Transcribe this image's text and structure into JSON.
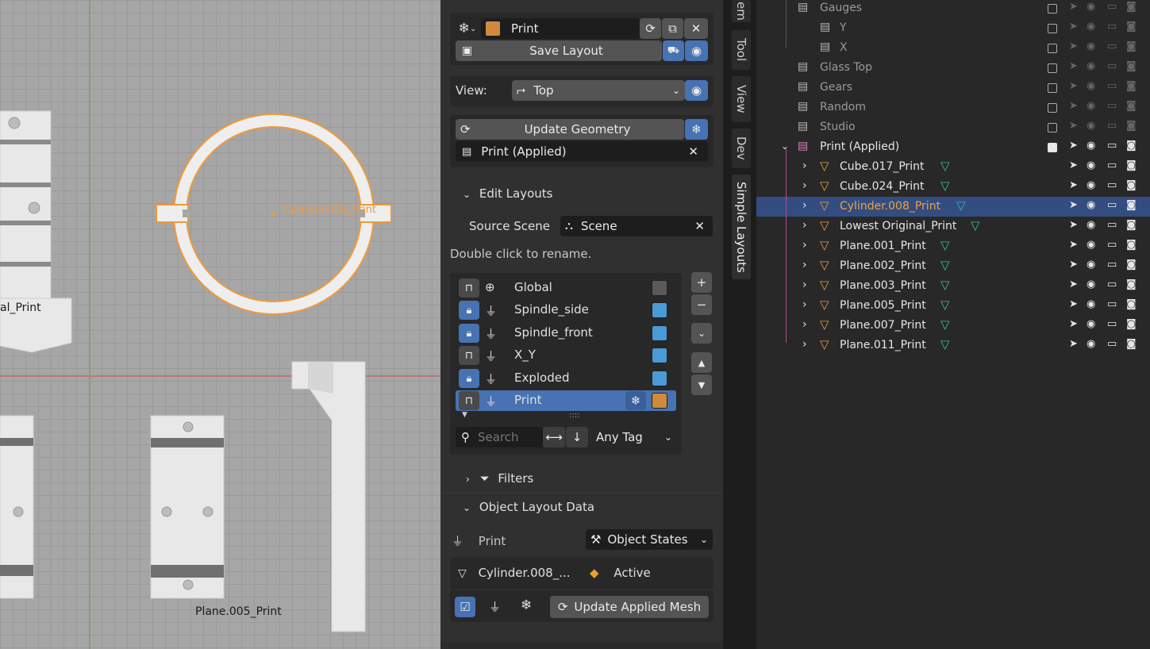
{
  "viewport": {
    "labels": {
      "cylinder": "Cylinder.008_Print",
      "plane005": "Plane.005_Print",
      "lowest": "al_Print"
    }
  },
  "npanel": {
    "layout": {
      "name": "Print",
      "save_label": "Save Layout",
      "color": "#d08a3c"
    },
    "view": {
      "label": "View:",
      "value": "Top"
    },
    "geometry": {
      "update_label": "Update Geometry",
      "collection": "Print (Applied)"
    },
    "edit_layouts": {
      "header": "Edit Layouts",
      "source_label": "Source Scene",
      "source_value": "Scene",
      "hint": "Double click to rename.",
      "items": [
        {
          "name": "Global",
          "locked": false,
          "color": "#5a5a5a"
        },
        {
          "name": "Spindle_side",
          "locked": true,
          "color": "#4a9ad6"
        },
        {
          "name": "Spindle_front",
          "locked": true,
          "color": "#4a9ad6"
        },
        {
          "name": "X_Y",
          "locked": false,
          "color": "#4a9ad6"
        },
        {
          "name": "Exploded",
          "locked": true,
          "color": "#4a9ad6"
        },
        {
          "name": "Print",
          "locked": false,
          "color": "#d08a3c"
        }
      ],
      "search_placeholder": "Search",
      "tag_filter": "Any Tag"
    },
    "filters": {
      "header": "Filters"
    },
    "object_layout": {
      "header": "Object Layout Data",
      "layout": "Print",
      "mode": "Object States",
      "object": "Cylinder.008_...",
      "state": "Active",
      "update_mesh_label": "Update Applied Mesh"
    }
  },
  "tabs": [
    "em",
    "Tool",
    "View",
    "Dev",
    "Simple Layouts"
  ],
  "outliner": {
    "rows": [
      {
        "name": "Gauges",
        "type": "collection",
        "dim": true
      },
      {
        "name": "Y",
        "type": "collection",
        "dim": true
      },
      {
        "name": "X",
        "type": "collection",
        "dim": true
      },
      {
        "name": "Glass Top",
        "type": "collection",
        "dim": true
      },
      {
        "name": "Gears",
        "type": "collection",
        "dim": true
      },
      {
        "name": "Random",
        "type": "collection",
        "dim": true
      },
      {
        "name": "Studio",
        "type": "collection",
        "dim": true
      },
      {
        "name": "Print (Applied)",
        "type": "collection",
        "dim": false
      },
      {
        "name": "Cube.017_Print",
        "type": "mesh",
        "dim": false
      },
      {
        "name": "Cube.024_Print",
        "type": "mesh",
        "dim": false
      },
      {
        "name": "Cylinder.008_Print",
        "type": "mesh",
        "dim": false,
        "selected": true
      },
      {
        "name": "Lowest Original_Print",
        "type": "mesh",
        "dim": false
      },
      {
        "name": "Plane.001_Print",
        "type": "mesh",
        "dim": false
      },
      {
        "name": "Plane.002_Print",
        "type": "mesh",
        "dim": false
      },
      {
        "name": "Plane.003_Print",
        "type": "mesh",
        "dim": false
      },
      {
        "name": "Plane.005_Print",
        "type": "mesh",
        "dim": false
      },
      {
        "name": "Plane.007_Print",
        "type": "mesh",
        "dim": false
      },
      {
        "name": "Plane.011_Print",
        "type": "mesh",
        "dim": false
      }
    ]
  },
  "colors": {
    "accent_blue": "#4772b3",
    "selection": "#334d80",
    "orange": "#e89a40",
    "mesh_green": "#35c29a"
  }
}
